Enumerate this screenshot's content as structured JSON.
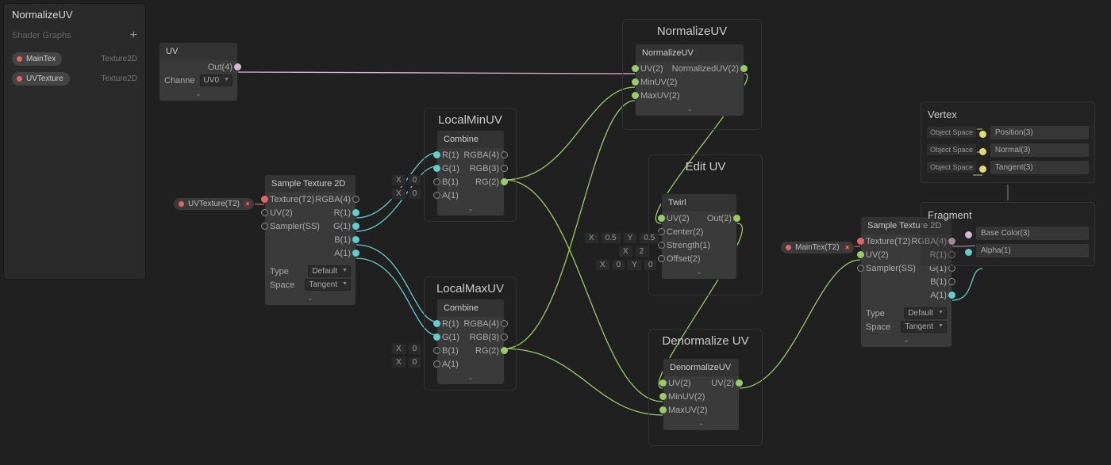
{
  "blackboard": {
    "title": "NormalizeUV",
    "subtitle": "Shader Graphs",
    "props": [
      {
        "name": "MainTex",
        "type": "Texture2D",
        "color": "#e06666"
      },
      {
        "name": "UVTexture",
        "type": "Texture2D",
        "color": "#e06666"
      }
    ]
  },
  "groups": {
    "localmin": "LocalMinUV",
    "localmax": "LocalMaxUV",
    "normalize": "NormalizeUV",
    "edit": "Edit UV",
    "denorm": "Denormalize UV"
  },
  "nodes": {
    "uv": {
      "title": "UV",
      "out": "Out(4)",
      "opt_label": "Channe",
      "opt_value": "UV0"
    },
    "sample1": {
      "title": "Sample Texture 2D",
      "in": [
        "Texture(T2)",
        "UV(2)",
        "Sampler(SS)"
      ],
      "out": [
        "RGBA(4)",
        "R(1)",
        "G(1)",
        "B(1)",
        "A(1)"
      ],
      "settings": [
        {
          "label": "Type",
          "value": "Default"
        },
        {
          "label": "Space",
          "value": "Tangent"
        }
      ]
    },
    "combine1": {
      "title": "Combine",
      "in": [
        "R(1)",
        "G(1)",
        "B(1)",
        "A(1)"
      ],
      "out": [
        "RGBA(4)",
        "RGB(3)",
        "RG(2)"
      ],
      "floats": [
        [
          "X",
          "0"
        ],
        [
          "X",
          "0"
        ]
      ]
    },
    "combine2": {
      "title": "Combine",
      "in": [
        "R(1)",
        "G(1)",
        "B(1)",
        "A(1)"
      ],
      "out": [
        "RGBA(4)",
        "RGB(3)",
        "RG(2)"
      ],
      "floats": [
        [
          "X",
          "0"
        ],
        [
          "X",
          "0"
        ]
      ]
    },
    "normalizeuv": {
      "title": "NormalizeUV",
      "in": [
        "UV(2)",
        "MinUV(2)",
        "MaxUV(2)"
      ],
      "out": [
        "NormalizedUV(2)"
      ]
    },
    "twirl": {
      "title": "Twirl",
      "in": [
        "UV(2)",
        "Center(2)",
        "Strength(1)",
        "Offset(2)"
      ],
      "out": [
        "Out(2)"
      ],
      "center": [
        "X",
        "0.5",
        "Y",
        "0.5"
      ],
      "strength": [
        "X",
        "2"
      ],
      "offset": [
        "X",
        "0",
        "Y",
        "0"
      ]
    },
    "denorm": {
      "title": "DenormalizeUV",
      "in": [
        "UV(2)",
        "MinUV(2)",
        "MaxUV(2)"
      ],
      "out": [
        "UV(2)"
      ]
    },
    "sample2": {
      "title": "Sample Texture 2D",
      "in": [
        "Texture(T2)",
        "UV(2)",
        "Sampler(SS)"
      ],
      "out": [
        "RGBA(4)",
        "R(1)",
        "G(1)",
        "B(1)",
        "A(1)"
      ],
      "settings": [
        {
          "label": "Type",
          "value": "Default"
        },
        {
          "label": "Space",
          "value": "Tangent"
        }
      ]
    }
  },
  "tokens": {
    "uvtex": "UVTexture(T2)",
    "maintex": "MainTex(T2)"
  },
  "master": {
    "vertex": {
      "title": "Vertex",
      "rows": [
        {
          "tag": "Object Space",
          "slot": "Position(3)"
        },
        {
          "tag": "Object Space",
          "slot": "Normal(3)"
        },
        {
          "tag": "Object Space",
          "slot": "Tangent(3)"
        }
      ]
    },
    "fragment": {
      "title": "Fragment",
      "rows": [
        {
          "tag": "",
          "slot": "Base Color(3)"
        },
        {
          "tag": "",
          "slot": "Alpha(1)"
        }
      ]
    }
  },
  "collapse": "⌄"
}
